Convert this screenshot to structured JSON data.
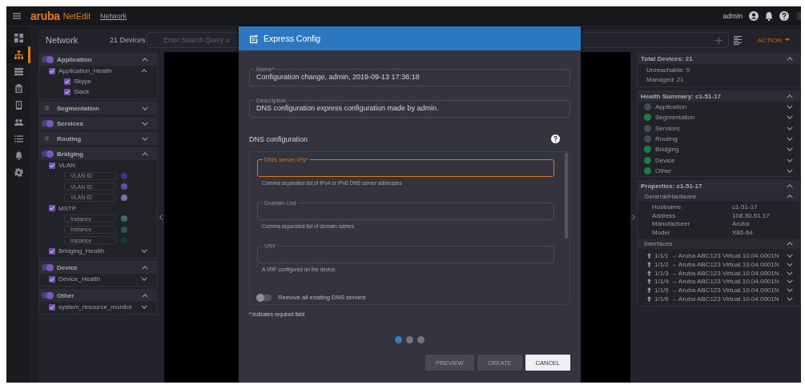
{
  "topbar": {
    "brand": "aruba",
    "product": "NetEdit",
    "breadcrumb": "Network",
    "user": "admin"
  },
  "rail": [
    {
      "kind": "grid",
      "selected": false
    },
    {
      "kind": "tree",
      "selected": true
    },
    {
      "kind": "rows",
      "selected": false
    },
    {
      "kind": "clipboard",
      "selected": false
    },
    {
      "kind": "tablet",
      "selected": false
    },
    {
      "kind": "people",
      "selected": false
    },
    {
      "kind": "list",
      "selected": false
    },
    {
      "kind": "bell",
      "selected": false
    },
    {
      "kind": "gear",
      "selected": false
    }
  ],
  "network": {
    "title": "Network",
    "device_count": "21 Devices",
    "placeholder": "Enter Search Query o",
    "action": "ACTION"
  },
  "filters": [
    {
      "label": "Application",
      "on": true,
      "expanded": true,
      "items": [
        {
          "label": "Application_Health",
          "checked": true,
          "expanded": true,
          "children": [
            {
              "label": "Skype",
              "checked": true
            },
            {
              "label": "Slack",
              "checked": true
            }
          ]
        }
      ]
    },
    {
      "label": "Segmentation",
      "on": false,
      "expanded": false
    },
    {
      "label": "Services",
      "on": true,
      "expanded": false
    },
    {
      "label": "Routing",
      "on": false,
      "expanded": false
    },
    {
      "label": "Bridging",
      "on": true,
      "expanded": true,
      "items": [
        {
          "label": "VLAN",
          "checked": true,
          "fields": [
            {
              "placeholder": "VLAN ID",
              "color": "#3e3383"
            },
            {
              "placeholder": "VLAN ID",
              "color": "#5f4f9c"
            },
            {
              "placeholder": "VLAN ID",
              "color": "#7e6fa8"
            }
          ]
        },
        {
          "label": "MSTP",
          "checked": true,
          "fields": [
            {
              "placeholder": "Instance",
              "color": "#3d6a6c"
            },
            {
              "placeholder": "Instance",
              "color": "#2b5658"
            },
            {
              "placeholder": "Instance",
              "color": "#123838"
            }
          ]
        },
        {
          "label": "Bridging_Health",
          "checked": true,
          "expanded": false
        }
      ]
    },
    {
      "label": "Device",
      "on": true,
      "expanded": true,
      "items": [
        {
          "label": "Device_Health",
          "checked": true,
          "expanded": false
        }
      ]
    },
    {
      "label": "Other",
      "on": true,
      "expanded": true,
      "items": [
        {
          "label": "system_resource_monitor",
          "checked": true,
          "expanded": false
        }
      ]
    }
  ],
  "right_panel": {
    "summary": {
      "title": "Total Devices: 21",
      "expanded": true,
      "lines": [
        "Unreachable: 0",
        "Managed: 21"
      ]
    },
    "health": {
      "title": "Health Summary: c1-51-17",
      "expanded": true,
      "items": [
        {
          "label": "Application",
          "color": "#474a57",
          "expanded": false
        },
        {
          "label": "Segmentation",
          "color": "#1f7a48",
          "expanded": false
        },
        {
          "label": "Services",
          "color": "#474a57",
          "expanded": false
        },
        {
          "label": "Routing",
          "color": "#474a57",
          "expanded": false
        },
        {
          "label": "Bridging",
          "color": "#1f7a48",
          "expanded": false
        },
        {
          "label": "Device",
          "color": "#1f7a48",
          "expanded": false
        },
        {
          "label": "Other",
          "color": "#1f7a48",
          "expanded": false
        }
      ]
    },
    "properties": {
      "title": "Properties: c1-51-17",
      "expanded": true,
      "sections": [
        {
          "title": "General/Hardware",
          "expanded": true,
          "kind": "pairs",
          "rows": [
            {
              "key": "Hostname",
              "value": "c1-51-17"
            },
            {
              "key": "Address",
              "value": "108.30.51.17"
            },
            {
              "key": "Manufacturer",
              "value": "Aruba"
            },
            {
              "key": "Model",
              "value": "X86-64"
            }
          ]
        },
        {
          "title": "Interfaces",
          "expanded": true,
          "kind": "links",
          "rows": [
            {
              "text": "1/1/1 → Aruba ABC123 Virtual.10.04.0001N",
              "expanded": false
            },
            {
              "text": "1/1/2 → Aruba ABC123 Virtual.10.04.0001N",
              "expanded": false
            },
            {
              "text": "1/1/3 → Aruba ABC123 Virtual.10.04.0001N",
              "expanded": false
            },
            {
              "text": "1/1/4 → Aruba ABC123 Virtual.10.04.0001N",
              "expanded": false
            },
            {
              "text": "1/1/5 → Aruba ABC123 Virtual.10.04.0001N",
              "expanded": false
            },
            {
              "text": "1/1/6 → Aruba ABC123 Virtual.10.04.0001N",
              "expanded": false
            }
          ]
        }
      ]
    }
  },
  "dialog": {
    "title": "Express Config",
    "fields": [
      {
        "label": "Name*",
        "value": "Configuration change, admin, 2019-09-13 17:36:18"
      },
      {
        "label": "Description",
        "value": "DNS configuration express configuration made by admin."
      }
    ],
    "section_title": "DNS configuration",
    "dns_fields": [
      {
        "label": "DNS server IPs*",
        "focused": true,
        "helper": "Comma separated list of IPv4 or IPv6 DNS server addresses"
      },
      {
        "label": "Domain List",
        "focused": false,
        "helper": "Comma separated list of domain names"
      },
      {
        "label": "VRF",
        "focused": false,
        "helper": "A VRF configured on the device."
      }
    ],
    "toggle": {
      "label": "Remove all existing DNS servers",
      "on": false
    },
    "required_note": "* indicates required field",
    "steps": [
      {
        "selected": true
      },
      {
        "selected": false
      },
      {
        "selected": false
      }
    ],
    "buttons": [
      {
        "label": "PREVIEW",
        "disabled": true
      },
      {
        "label": "CREATE",
        "disabled": true
      },
      {
        "label": "CANCEL",
        "disabled": false
      }
    ]
  }
}
